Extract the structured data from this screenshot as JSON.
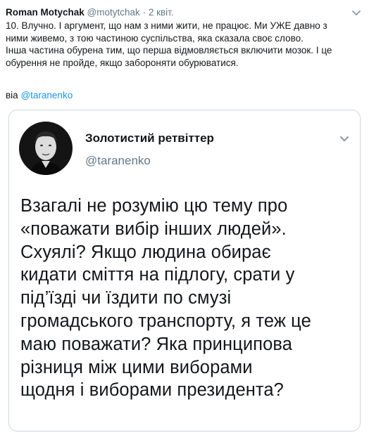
{
  "tweet": {
    "author_name": "Roman Motychak",
    "author_handle": "@motytchak",
    "separator": "·",
    "timestamp": "2 квіт.",
    "body_lines": [
      "10. Влучно. І аргумент, що нам з ними жити, не працює. Ми УЖЕ давно з",
      "ними живемо, з тою  частиною суспільства, яка сказала своє слово.",
      "Інша частина обурена тим, що перша відмовляється включити мозок. І це",
      "обурення не пройде, якщо забороняти обурюватися."
    ],
    "via_label": "віа",
    "via_handle": "@taranenko"
  },
  "embedded": {
    "name": "Золотистий ретвіттер",
    "handle": "@taranenko",
    "text_lines": [
      "Взагалі не розумію цю тему про",
      "«поважати вибір інших людей».",
      "Схуялі? Якщо людина обирає",
      "кидати сміття на підлогу, срати у",
      "під’їзді чи їздити по смузі",
      "громадського транспорту, я теж це",
      "маю поважати? Яка принципова",
      "різниця між цими виборами",
      "щодня і виборами президента?"
    ]
  },
  "icons": {
    "menu": "chevron-down-icon",
    "avatar": "avatar-portrait"
  },
  "colors": {
    "text": "#14171a",
    "secondary": "#657786",
    "link": "#1b95e0",
    "border": "#d0d7de"
  }
}
